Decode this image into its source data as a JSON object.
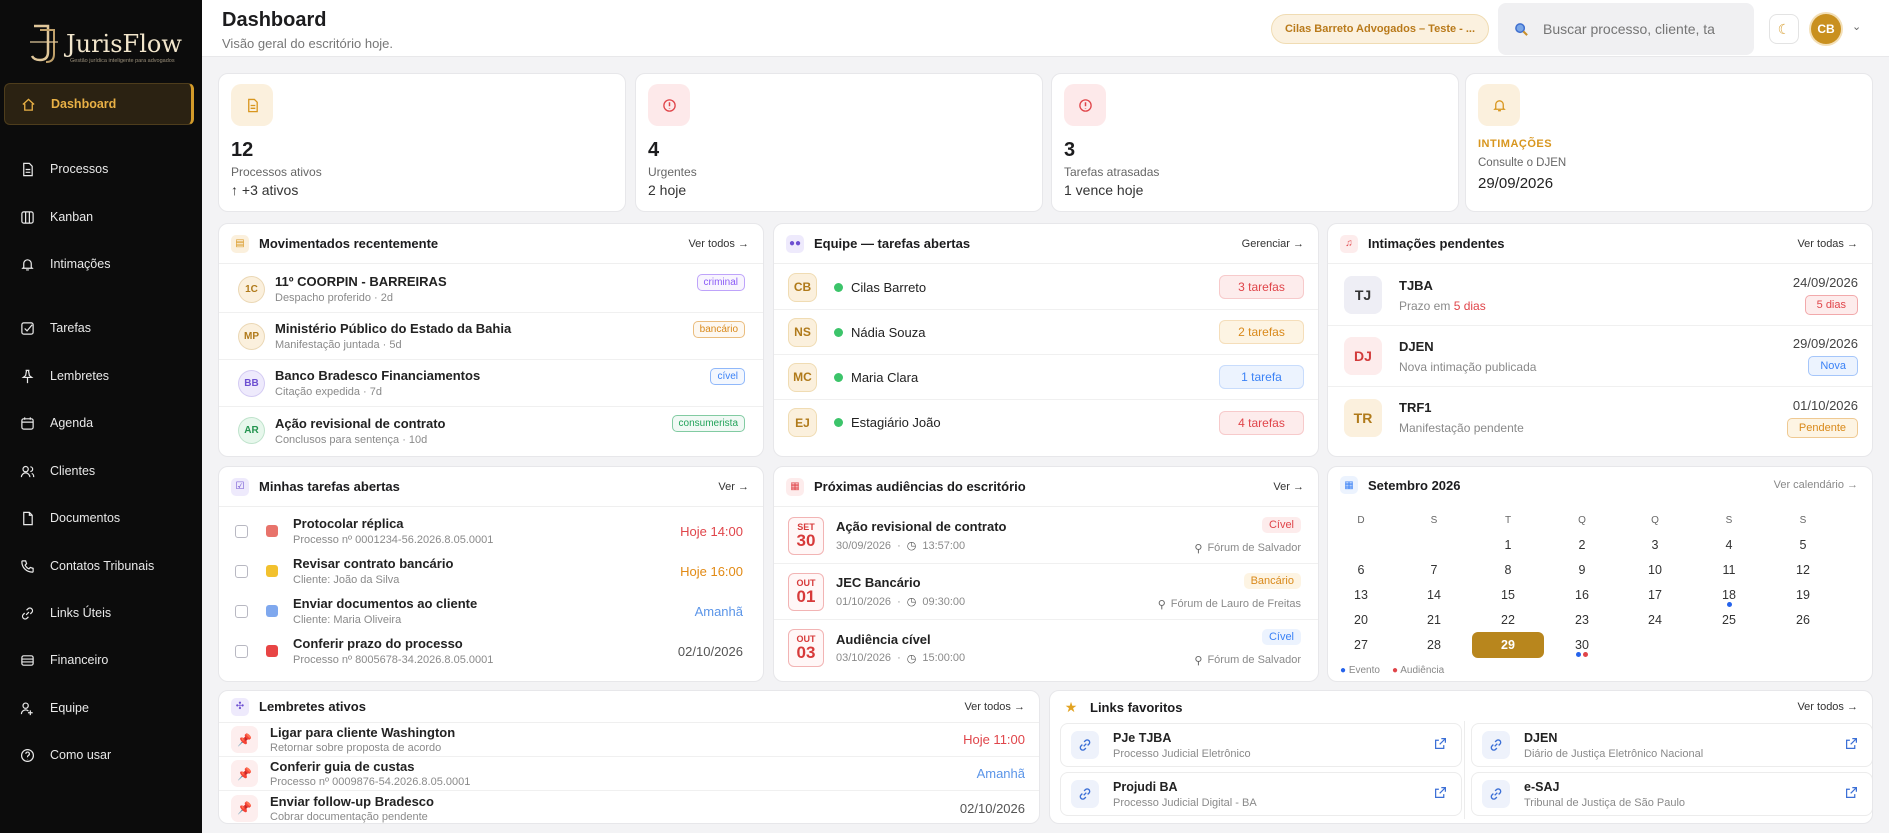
{
  "brand": {
    "name": "JurisFlow",
    "tagline": "Gestão jurídica inteligente para advogados"
  },
  "nav": [
    {
      "label": "Dashboard",
      "icon": "home-icon",
      "active": true
    },
    {
      "label": "Processos",
      "icon": "document-icon"
    },
    {
      "label": "Kanban",
      "icon": "columns-icon"
    },
    {
      "label": "Intimações",
      "icon": "bell-icon"
    },
    {
      "label": "Tarefas",
      "icon": "checkbox-icon"
    },
    {
      "label": "Lembretes",
      "icon": "pin-icon"
    },
    {
      "label": "Agenda",
      "icon": "calendar-icon"
    },
    {
      "label": "Clientes",
      "icon": "users-icon"
    },
    {
      "label": "Documentos",
      "icon": "file-icon"
    },
    {
      "label": "Contatos Tribunais",
      "icon": "phone-icon"
    },
    {
      "label": "Links Úteis",
      "icon": "link-icon"
    },
    {
      "label": "Financeiro",
      "icon": "wallet-icon"
    },
    {
      "label": "Equipe",
      "icon": "team-icon"
    },
    {
      "label": "Como usar",
      "icon": "help-icon"
    }
  ],
  "header": {
    "title": "Dashboard",
    "subtitle": "Visão geral do escritório hoje.",
    "firm": "Cilas Barreto Advogados – Teste - ...",
    "search_placeholder": "Buscar processo, cliente, ta",
    "avatar": "CB"
  },
  "stats": [
    {
      "value": "12",
      "label": "Processos ativos",
      "foot": "↑ +3 ativos",
      "color": "#d8961e",
      "bg": "#fbf0dd"
    },
    {
      "value": "4",
      "label": "Urgentes",
      "foot": "2 hoje",
      "color": "#e0454a",
      "bg": "#fde9ea"
    },
    {
      "value": "3",
      "label": "Tarefas atrasadas",
      "foot": "1 vence hoje",
      "color": "#e0454a",
      "bg": "#fde9ea"
    }
  ],
  "intimacoes_card": {
    "title": "INTIMAÇÕES",
    "sub": "Consulte o DJEN",
    "date": "29/09/2026"
  },
  "recent": {
    "title": "Movimentados recentemente",
    "link": "Ver todos →",
    "items": [
      {
        "ini": "1C",
        "name": "11º COORPIN - BARREIRAS",
        "sub": "Despacho proferido · 2d",
        "tag": "criminal",
        "tc": "#8b5cf6",
        "ibg": "#fbf0dd",
        "ic": "#b07a1a"
      },
      {
        "ini": "MP",
        "name": "Ministério Público do Estado da Bahia",
        "sub": "Manifestação juntada · 5d",
        "tag": "bancário",
        "tc": "#d9891a",
        "ibg": "#fbf0dd",
        "ic": "#b07a1a"
      },
      {
        "ini": "BB",
        "name": "Banco Bradesco Financiamentos",
        "sub": "Citação expedida · 7d",
        "tag": "cível",
        "tc": "#3b82f6",
        "ibg": "#eeeafc",
        "ic": "#6d4fd1"
      },
      {
        "ini": "AR",
        "name": "Ação revisional de contrato",
        "sub": "Conclusos para sentença · 10d",
        "tag": "consumerista",
        "tc": "#22a35a",
        "ibg": "#e7f7ec",
        "ic": "#23944f"
      }
    ]
  },
  "team": {
    "title": "Equipe — tarefas abertas",
    "link": "Gerenciar →",
    "items": [
      {
        "ini": "CB",
        "name": "Cilas Barreto",
        "count": "3 tarefas",
        "pc": "#e0454a",
        "pbg": "#fdecec"
      },
      {
        "ini": "NS",
        "name": "Nádia Souza",
        "count": "2 tarefas",
        "pc": "#d9891a",
        "pbg": "#fdf4e3"
      },
      {
        "ini": "MC",
        "name": "Maria Clara",
        "count": "1 tarefa",
        "pc": "#3b82f6",
        "pbg": "#ecf3fe"
      },
      {
        "ini": "EJ",
        "name": "Estagiário João",
        "count": "4 tarefas",
        "pc": "#e0454a",
        "pbg": "#fdecec"
      }
    ]
  },
  "pending": {
    "title": "Intimações pendentes",
    "link": "Ver todas →",
    "items": [
      {
        "ini": "TJ",
        "name": "TJBA",
        "sub_pre": "Prazo em ",
        "sub_hl": "5 dias",
        "date": "24/09/2026",
        "badge": "5 dias",
        "bc": "#e0454a",
        "bbg": "#fdecec",
        "ibg": "#eeeef5",
        "ic": "#333"
      },
      {
        "ini": "DJ",
        "name": "DJEN",
        "sub_pre": "Nova intimação publicada",
        "sub_hl": "",
        "date": "29/09/2026",
        "badge": "Nova",
        "bc": "#3b82f6",
        "bbg": "#ecf3fe",
        "ibg": "#fdecec",
        "ic": "#d23b3b"
      },
      {
        "ini": "TR",
        "name": "TRF1",
        "sub_pre": "Manifestação pendente",
        "sub_hl": "",
        "date": "01/10/2026",
        "badge": "Pendente",
        "bc": "#d9891a",
        "bbg": "#fdf4e3",
        "ibg": "#fbf0dd",
        "ic": "#b07a1a"
      }
    ]
  },
  "tasks": {
    "title": "Minhas tarefas abertas",
    "link": "Ver →",
    "items": [
      {
        "name": "Protocolar réplica",
        "sub": "Processo nº 0001234-56.2026.8.05.0001",
        "due": "Hoje 14:00",
        "dc": "#e0454a",
        "sq": "#e8736b"
      },
      {
        "name": "Revisar contrato bancário",
        "sub": "Cliente: João da Silva",
        "due": "Hoje 16:00",
        "dc": "#e28a14",
        "sq": "#f2c12e"
      },
      {
        "name": "Enviar documentos ao cliente",
        "sub": "Cliente: Maria Oliveira",
        "due": "Amanhã",
        "dc": "#5b95e8",
        "sq": "#7fa8ee"
      },
      {
        "name": "Conferir prazo do processo",
        "sub": "Processo nº 8005678-34.2026.8.05.0001",
        "due": "02/10/2026",
        "dc": "#555",
        "sq": "#e84545"
      }
    ]
  },
  "hearings": {
    "title": "Próximas audiências do escritório",
    "link": "Ver →",
    "items": [
      {
        "mon": "SET",
        "day": "30",
        "name": "Ação revisional de contrato",
        "date": "30/09/2026",
        "time": "13:57:00",
        "tag": "Cível",
        "tc": "#e0454a",
        "tbg": "#fdecec",
        "place": "Fórum de Salvador"
      },
      {
        "mon": "OUT",
        "day": "01",
        "name": "JEC Bancário",
        "date": "01/10/2026",
        "time": "09:30:00",
        "tag": "Bancário",
        "tc": "#d9891a",
        "tbg": "#fdf4e3",
        "place": "Fórum de Lauro de Freitas"
      },
      {
        "mon": "OUT",
        "day": "03",
        "name": "Audiência cível",
        "date": "03/10/2026",
        "time": "15:00:00",
        "tag": "Cível",
        "tc": "#3b82f6",
        "tbg": "#ecf3fe",
        "place": "Fórum de Salvador"
      }
    ]
  },
  "calendar": {
    "title": "Setembro 2026",
    "link": "Ver calendário →",
    "weekdays": [
      "D",
      "S",
      "T",
      "Q",
      "Q",
      "S",
      "S"
    ],
    "weeks": [
      [
        "",
        "",
        "1",
        "2",
        "3",
        "4",
        "5"
      ],
      [
        "6",
        "7",
        "8",
        "9",
        "10",
        "11",
        "12"
      ],
      [
        "13",
        "14",
        "15",
        "16",
        "17",
        "18",
        "19"
      ],
      [
        "20",
        "21",
        "22",
        "23",
        "24",
        "25",
        "26"
      ],
      [
        "27",
        "28",
        "29",
        "30",
        "",
        "",
        ""
      ]
    ],
    "today": "29",
    "legend": [
      "Evento",
      "Audiência"
    ]
  },
  "reminders": {
    "title": "Lembretes ativos",
    "link": "Ver todos →",
    "items": [
      {
        "name": "Ligar para cliente Washington",
        "sub": "Retornar sobre proposta de acordo",
        "due": "Hoje 11:00",
        "dc": "#e0454a"
      },
      {
        "name": "Conferir guia de custas",
        "sub": "Processo nº 0009876-54.2026.8.05.0001",
        "due": "Amanhã",
        "dc": "#5b95e8"
      },
      {
        "name": "Enviar follow-up Bradesco",
        "sub": "Cobrar documentação pendente",
        "due": "02/10/2026",
        "dc": "#555"
      }
    ]
  },
  "links": {
    "title": "Links favoritos",
    "link": "Ver todos →",
    "items": [
      {
        "name": "PJe TJBA",
        "sub": "Processo Judicial Eletrônico"
      },
      {
        "name": "DJEN",
        "sub": "Diário de Justiça Eletrônico Nacional"
      },
      {
        "name": "Projudi BA",
        "sub": "Processo Judicial Digital - BA"
      },
      {
        "name": "e-SAJ",
        "sub": "Tribunal de Justiça de São Paulo"
      }
    ]
  }
}
